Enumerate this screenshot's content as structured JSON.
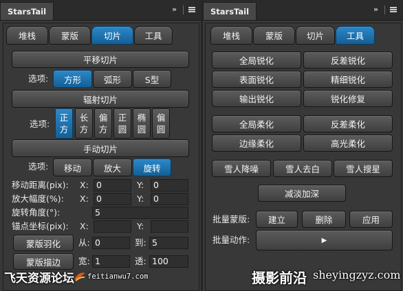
{
  "left": {
    "title": "StarsTail",
    "tabs": [
      "堆栈",
      "蒙版",
      "切片",
      "工具"
    ],
    "pan": {
      "header": "平移切片",
      "label": "选项:",
      "options": [
        "方形",
        "弧形",
        "S型"
      ]
    },
    "radial": {
      "header": "辐射切片",
      "label": "选项:",
      "options": [
        [
          "正",
          "方"
        ],
        [
          "长",
          "方"
        ],
        [
          "偏",
          "方"
        ],
        [
          "正",
          "圆"
        ],
        [
          "椭",
          "圆"
        ],
        [
          "偏",
          "圆"
        ]
      ]
    },
    "manual": {
      "header": "手动切片",
      "label": "选项:",
      "options": [
        "移动",
        "放大",
        "旋转"
      ],
      "move_label": "移动距离(pix):",
      "scale_label": "放大幅度(%):",
      "rotate_label": "旋转角度(°):",
      "anchor_label": "锚点坐标(pix):",
      "x": "X:",
      "y": "Y:",
      "move_x": "0",
      "move_y": "0",
      "scale_x": "0",
      "scale_y": "0",
      "rotate": "5",
      "anchor_x": "",
      "anchor_y": ""
    },
    "feather": {
      "button": "蒙版羽化",
      "from": "从:",
      "from_value": "0",
      "to": "到:",
      "to_value": "5"
    },
    "stroke": {
      "button": "蒙版描边",
      "width": "宽:",
      "width_value": "1",
      "opacity": "透:",
      "opacity_value": "100"
    }
  },
  "right": {
    "title": "StarsTail",
    "tabs": [
      "堆栈",
      "蒙版",
      "切片",
      "工具"
    ],
    "sharpen": [
      "全局锐化",
      "反差锐化",
      "表面锐化",
      "精细锐化",
      "输出锐化",
      "锐化修复"
    ],
    "soften": [
      "全局柔化",
      "反差柔化",
      "边缘柔化",
      "高光柔化"
    ],
    "snow": [
      "雪人降噪",
      "雪人去白",
      "雪人搜星"
    ],
    "dodge": "减淡加深",
    "batch_mask": {
      "label": "批量蒙版:",
      "buttons": [
        "建立",
        "删除",
        "应用"
      ]
    },
    "batch_action": {
      "label": "批量动作:",
      "play": "▶"
    }
  },
  "titlebar": {
    "collapse": "»"
  },
  "watermarks": {
    "left_main": "飞天资源论坛",
    "left_url": "feitianwu7.com",
    "right_main": "摄影前沿",
    "right_url": "sheyingzyz.com"
  },
  "colors": {
    "panel": "#383838",
    "accent": "#1f78b8"
  }
}
